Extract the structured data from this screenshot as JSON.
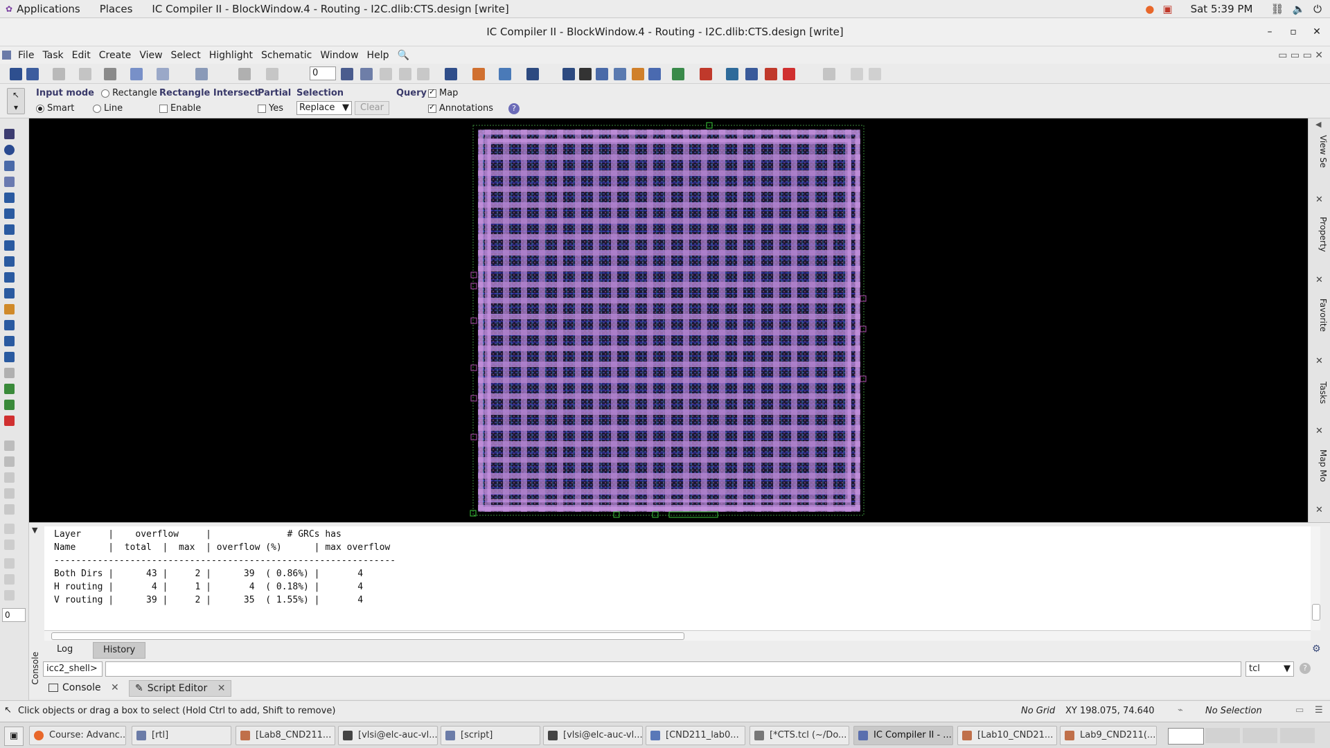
{
  "gnome_bar": {
    "applications": "Applications",
    "places": "Places",
    "window_name": "IC Compiler II - BlockWindow.4 - Routing - I2C.dlib:CTS.design [write]",
    "clock": "Sat  5:39 PM"
  },
  "window": {
    "title": "IC Compiler II - BlockWindow.4 - Routing - I2C.dlib:CTS.design [write]",
    "minimize": "–",
    "maximize": "▫",
    "close": "✕"
  },
  "menubar": {
    "items": [
      "File",
      "Task",
      "Edit",
      "Create",
      "View",
      "Select",
      "Highlight",
      "Schematic",
      "Window",
      "Help"
    ]
  },
  "toolbar": {
    "zoom_value": "0"
  },
  "options": {
    "input_mode": {
      "label": "Input mode",
      "rectangle": "Rectangle",
      "smart": "Smart",
      "line": "Line",
      "selected": "Smart"
    },
    "rect_intersect": {
      "label": "Rectangle Intersect",
      "enable": "Enable",
      "checked": false
    },
    "partial": {
      "label": "Partial",
      "yes": "Yes",
      "checked": false
    },
    "selection": {
      "label": "Selection",
      "value": "Replace",
      "clear": "Clear"
    },
    "query": {
      "label": "Query",
      "map": "Map",
      "map_checked": true,
      "annotations": "Annotations",
      "annotations_checked": true
    }
  },
  "left_input_value": "0",
  "right_dock": {
    "tabs": [
      "View Se",
      "Property",
      "Favorite",
      "Tasks",
      "Map Mo"
    ]
  },
  "report": {
    "lines": [
      "Layer     |    overflow     |              # GRCs has",
      "Name      |  total  |  max  | overflow (%)      | max overflow",
      "---------------------------------------------------------------",
      "Both Dirs |      43 |     2 |      39  ( 0.86%) |       4",
      "H routing |       4 |     1 |       4  ( 0.18%) |       4",
      "V routing |      39 |     2 |      35  ( 1.55%) |       4"
    ]
  },
  "console": {
    "side_label": "Console",
    "log_tab": "Log",
    "history_tab": "History",
    "prompt": "icc2_shell>",
    "command": "",
    "lang": "tcl",
    "bottom_tabs": [
      "Console",
      "Script Editor"
    ]
  },
  "statusbar": {
    "hint": "Click objects or drag a box to select (Hold Ctrl to add, Shift to remove)",
    "grid": "No Grid",
    "coords": "XY 198.075, 74.640",
    "selection": "No Selection"
  },
  "taskbar": {
    "items": [
      {
        "label": "Course: Advanc...",
        "color": "#e8672a"
      },
      {
        "label": "[rtl]",
        "color": "#6b7ca8"
      },
      {
        "label": "[Lab8_CND211...",
        "color": "#c0704a"
      },
      {
        "label": "[vlsi@elc-auc-vl...",
        "color": "#444"
      },
      {
        "label": "[script]",
        "color": "#6b7ca8"
      },
      {
        "label": "[vlsi@elc-auc-vl...",
        "color": "#444"
      },
      {
        "label": "[CND211_lab0...",
        "color": "#5a78b8"
      },
      {
        "label": "[*CTS.tcl (~/Do...",
        "color": "#777"
      },
      {
        "label": "IC Compiler II - ...",
        "color": "#5a6fae"
      },
      {
        "label": "[Lab10_CND21...",
        "color": "#c0704a"
      },
      {
        "label": "Lab9_CND211(...",
        "color": "#c0704a"
      }
    ]
  }
}
